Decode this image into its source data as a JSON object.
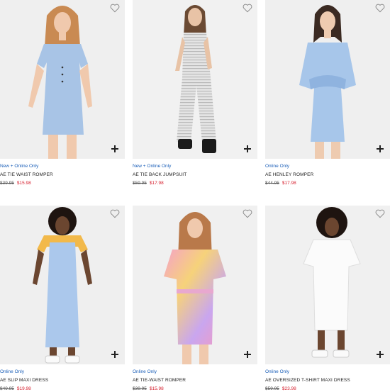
{
  "products": [
    {
      "badge": "New + Online Only",
      "name": "AE TIE WAIST ROMPER",
      "old_price": "$39.95",
      "sale_price": "$15.98",
      "icons": {
        "favorite": "heart-icon",
        "add": "plus-icon"
      }
    },
    {
      "badge": "New + Online Only",
      "name": "AE TIE BACK JUMPSUIT",
      "old_price": "$59.95",
      "sale_price": "$17.98",
      "icons": {
        "favorite": "heart-icon",
        "add": "plus-icon"
      }
    },
    {
      "badge": "Online Only",
      "name": "AE HENLEY ROMPER",
      "old_price": "$44.95",
      "sale_price": "$17.98",
      "icons": {
        "favorite": "heart-icon",
        "add": "plus-icon"
      }
    },
    {
      "badge": "Online Only",
      "name": "AE SLIP MAXI DRESS",
      "old_price": "$49.95",
      "sale_price": "$19.98",
      "icons": {
        "favorite": "heart-icon",
        "add": "plus-icon"
      }
    },
    {
      "badge": "Online Only",
      "name": "AE TIE-WAIST ROMPER",
      "old_price": "$39.95",
      "sale_price": "$15.98",
      "icons": {
        "favorite": "heart-icon",
        "add": "plus-icon"
      }
    },
    {
      "badge": "Online Only",
      "name": "AE OVERSIZED T-SHIRT MAXI DRESS",
      "old_price": "$59.95",
      "sale_price": "$23.98",
      "icons": {
        "favorite": "heart-icon",
        "add": "plus-icon"
      }
    }
  ],
  "colors": {
    "badge": "#1b5fb8",
    "sale": "#d6202e",
    "image_bg": "#f2f2f2"
  }
}
